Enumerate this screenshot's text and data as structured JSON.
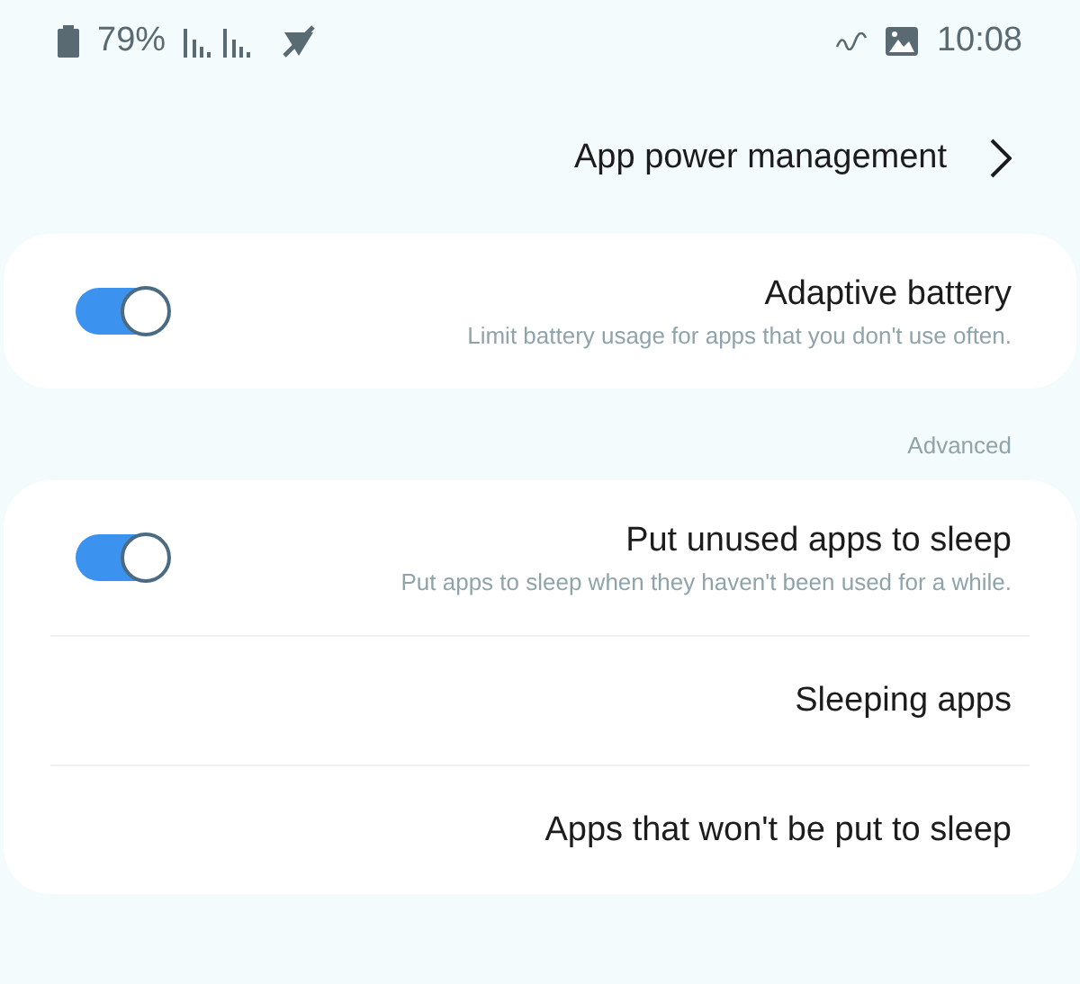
{
  "status_bar": {
    "time": "10:08",
    "battery": "79%"
  },
  "header": {
    "title": "App power management"
  },
  "cards": [
    {
      "items": [
        {
          "kind": "toggle",
          "title": "Adaptive battery",
          "subtitle": "Limit battery usage for apps that you don't use often.",
          "on": true
        }
      ]
    },
    {
      "section": "Advanced",
      "items": [
        {
          "kind": "toggle",
          "title": "Put unused apps to sleep",
          "subtitle": "Put apps to sleep when they haven't been used for a while.",
          "on": true
        },
        {
          "kind": "link",
          "title": "Sleeping apps"
        },
        {
          "kind": "link",
          "title": "Apps that won't be put to sleep"
        }
      ]
    }
  ]
}
